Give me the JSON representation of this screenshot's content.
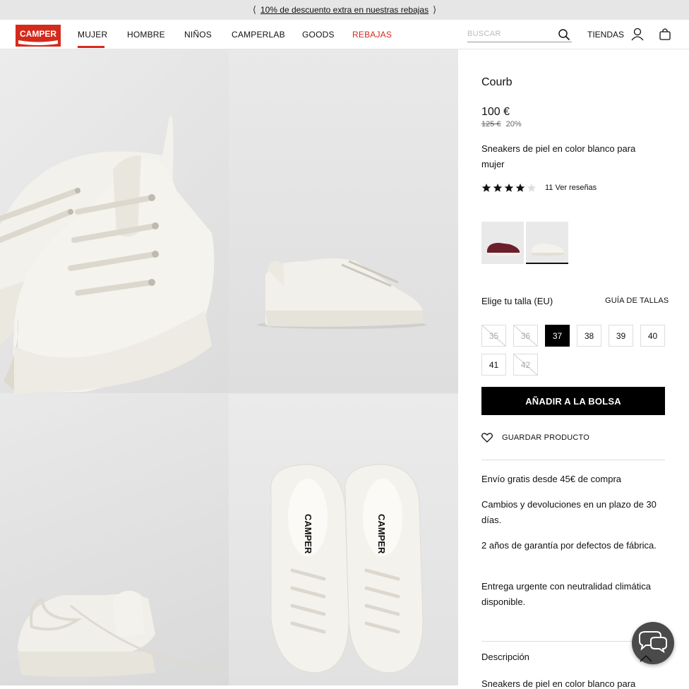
{
  "promo": {
    "text": "10% de descuento extra en nuestras rebajas",
    "prev_icon": "chevron-left-icon",
    "next_icon": "chevron-right-icon"
  },
  "nav": {
    "logo_text": "CAMPER",
    "items": [
      {
        "label": "MUJER"
      },
      {
        "label": "HOMBRE"
      },
      {
        "label": "NIÑOS"
      },
      {
        "label": "CAMPERLAB"
      },
      {
        "label": "GOODS"
      },
      {
        "label": "REBAJAS"
      }
    ],
    "search_placeholder": "BUSCAR",
    "stores": "TIENDAS",
    "sale_color": "#d42a1c",
    "accent_color": "#d42a1c"
  },
  "product": {
    "name": "Courb",
    "price": "100 €",
    "old_price": "125 €",
    "discount": "20%",
    "description": "Sneakers de piel en color blanco para mujer",
    "rating": 4,
    "rating_max": 5,
    "reviews": "11 Ver reseñas",
    "swatches": [
      {
        "color": "burgundy",
        "selected": false
      },
      {
        "color": "white",
        "selected": true
      }
    ],
    "size_title": "Elige tu talla (EU)",
    "size_guide": "GUÍA DE TALLAS",
    "sizes": [
      {
        "label": "35",
        "available": false,
        "selected": false
      },
      {
        "label": "36",
        "available": false,
        "selected": false
      },
      {
        "label": "37",
        "available": true,
        "selected": true
      },
      {
        "label": "38",
        "available": true,
        "selected": false
      },
      {
        "label": "39",
        "available": true,
        "selected": false
      },
      {
        "label": "40",
        "available": true,
        "selected": false
      },
      {
        "label": "41",
        "available": true,
        "selected": false
      },
      {
        "label": "42",
        "available": false,
        "selected": false
      }
    ],
    "add_to_bag": "AÑADIR A LA BOLSA",
    "save": "GUARDAR PRODUCTO",
    "info": [
      "Envío gratis desde 45€ de compra",
      "Cambios y devoluciones en un plazo de 30 días.",
      "2 años de garantía por defectos de fábrica.",
      "Entrega urgente con neutralidad climática disponible."
    ],
    "description_title": "Descripción",
    "description_text": "Sneakers de piel en color blanco para"
  }
}
